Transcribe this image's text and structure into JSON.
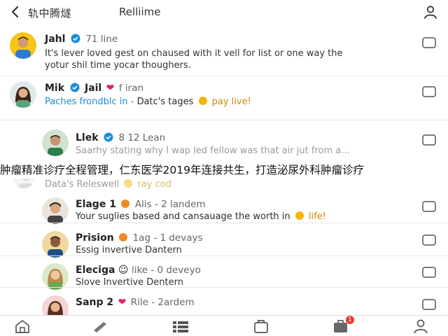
{
  "header": {
    "title": "轨中腾燧",
    "subtitle": "Relliime"
  },
  "feed": [
    {
      "name": "Jahl",
      "meta": "71 line",
      "verified": true,
      "text1": "It's lever loved gest on chaused with it vell for list or one way the",
      "text2": "yotur shil time yocar thoughers."
    },
    {
      "name": "Mik",
      "name2": "Jail",
      "meta": "f iran",
      "link_blue": "Paches frondblc in -",
      "link_plain": "Datc's tages",
      "link_gold": "pay live!"
    },
    {
      "name": "Llek",
      "meta": "8 12 Lean",
      "text1": "Saarhy stating why I wap led fellow was that air jut from a...",
      "faded_line": "Data's Releswell",
      "faded_gold": "ray cod"
    },
    {
      "name": "Elage 1",
      "meta": "Alis - 2 landem",
      "text1": "Your suglies based and cansauage the worth in",
      "link_gold": "life!"
    },
    {
      "name": "Prision",
      "meta": "1ag - 1 devays",
      "text1": "Essig invertive Dantern"
    },
    {
      "name": "Eleciga",
      "meta": "like - 0 deveyo",
      "text1": "Slove Invertive Dentern"
    },
    {
      "name": "Sanp 2",
      "meta": "Rile - 2ardem"
    }
  ],
  "overlay_banner": "肿瘤精准诊疗全程管理，仁东医学2019年连接共生，打造泌尿外科肿瘤诊疗",
  "nav": {
    "items": [
      "home-icon",
      "pen-icon",
      "list-icon",
      "bag-icon",
      "briefcase-icon",
      "person-icon"
    ],
    "notification_count": "1"
  },
  "colors": {
    "accent_blue": "#1a8cd8",
    "accent_gold": "#c98a00",
    "heart": "#e0245e",
    "badge": "#e53935"
  }
}
